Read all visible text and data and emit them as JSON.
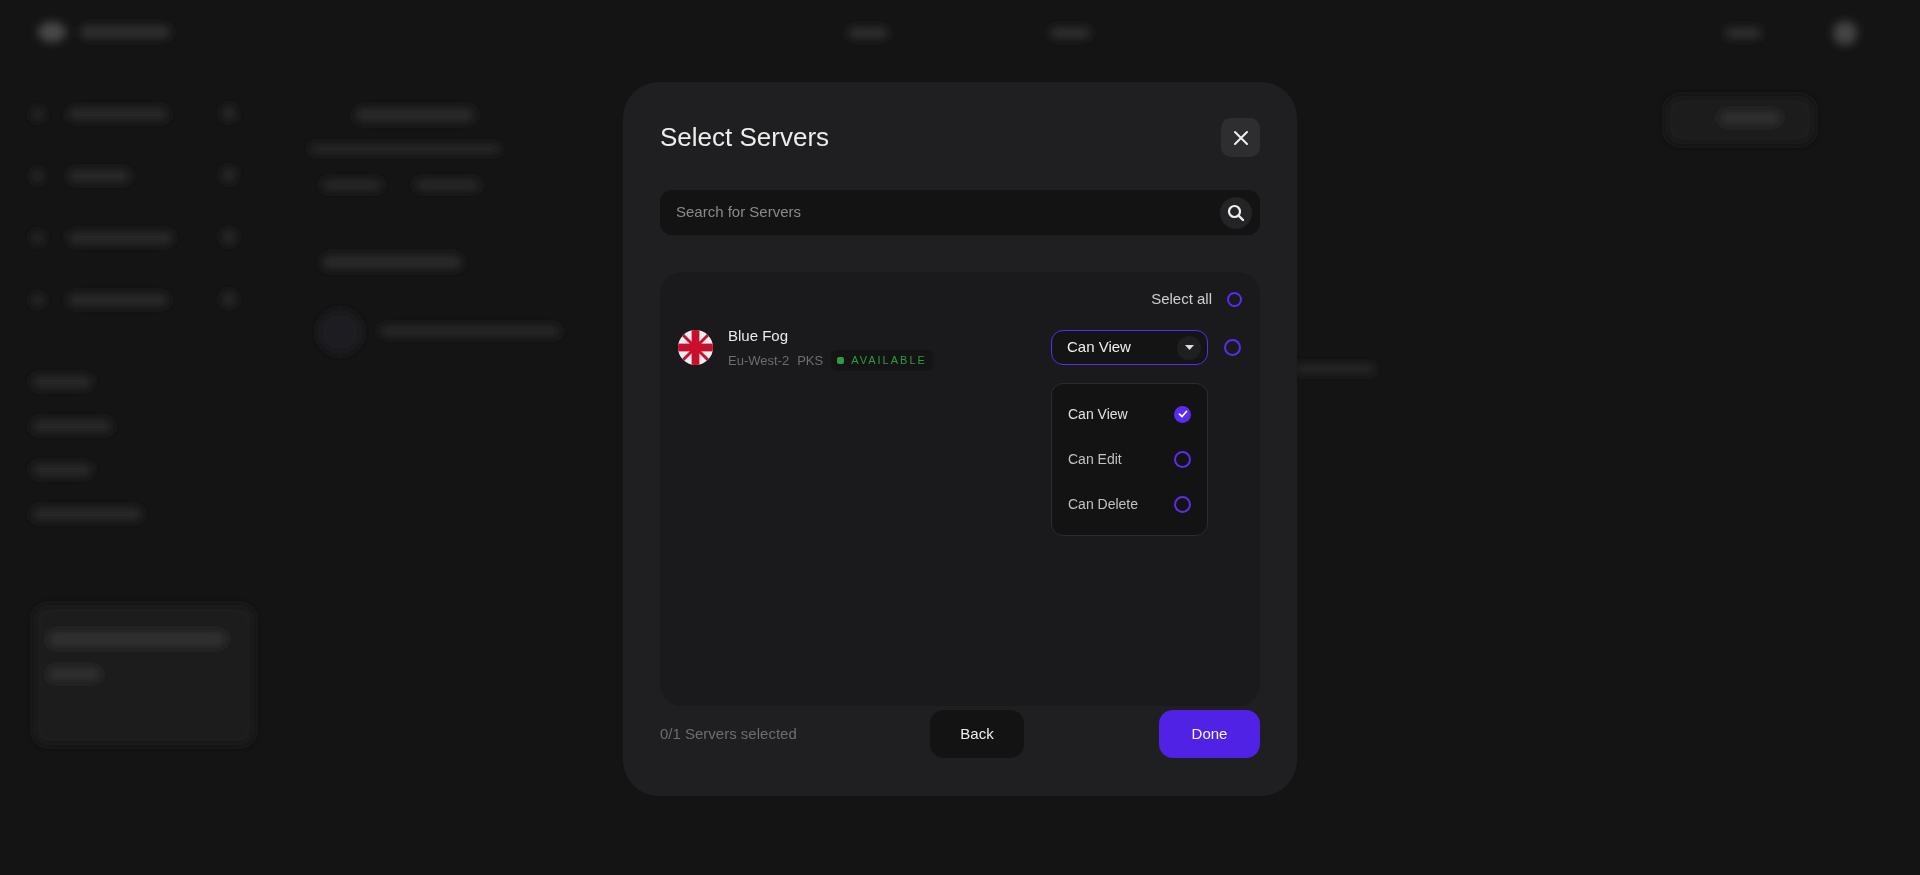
{
  "dialog": {
    "title": "Select Servers",
    "search": {
      "placeholder": "Search for Servers"
    },
    "select_all": {
      "label": "Select all",
      "checked": false
    },
    "servers": [
      {
        "name": "Blue Fog",
        "region": "Eu-West-2",
        "type": "PKS",
        "status": "AVAILABLE",
        "checked": false,
        "permission": "Can View",
        "expanded": true
      }
    ],
    "permission_options": [
      {
        "label": "Can View",
        "selected": true
      },
      {
        "label": "Can Edit",
        "selected": false
      },
      {
        "label": "Can Delete",
        "selected": false
      }
    ],
    "footer": {
      "count": "0/1 Servers selected",
      "buttons": [
        {
          "label": "Back",
          "kind": "secondary"
        },
        {
          "label": "Done",
          "kind": "primary"
        }
      ]
    }
  }
}
